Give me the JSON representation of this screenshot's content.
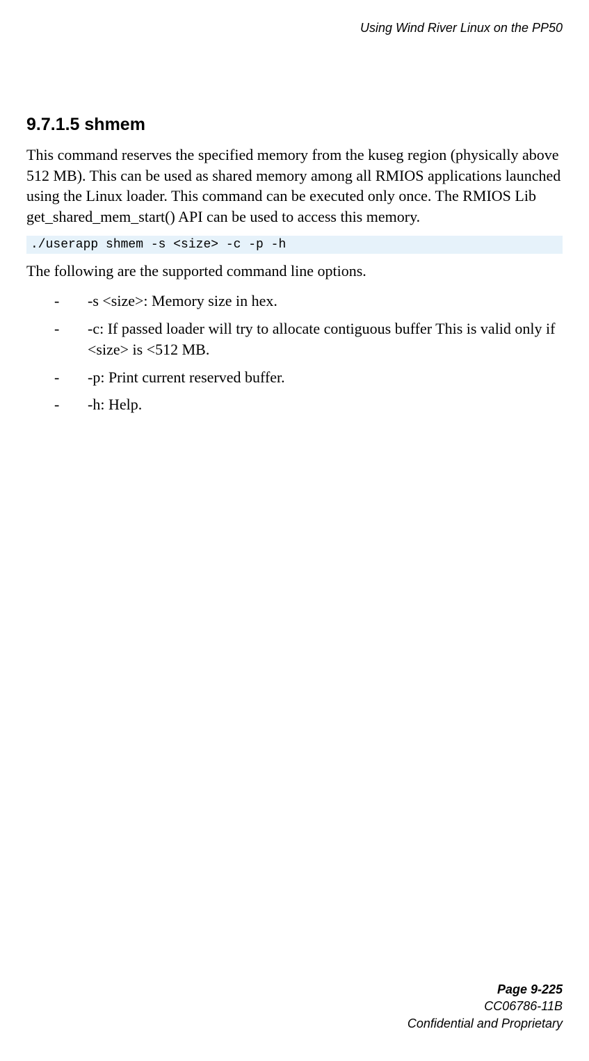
{
  "header": {
    "running_title": "Using Wind River Linux on the PP50"
  },
  "section": {
    "number": "9.7.1.5",
    "title": "shmem",
    "heading": "9.7.1.5 shmem",
    "description": "This command reserves the specified memory from the kuseg region (physically above 512 MB). This can be used as shared memory among all RMIOS applications launched using the Linux loader. This command can be executed only once. The RMIOS Lib get_shared_mem_start() API can be used to access this memory.",
    "command": "./userapp shmem -s <size> -c -p -h",
    "options_intro": "The following are the supported command line options.",
    "options": [
      "-s <size>: Memory size in hex.",
      "-c: If passed loader will try to allocate contiguous buffer This is valid only if <size> is <512 MB.",
      "-p: Print current reserved buffer.",
      "-h: Help."
    ]
  },
  "footer": {
    "page": "Page 9-225",
    "docid": "CC06786-11B",
    "confidentiality": "Confidential and Proprietary"
  }
}
